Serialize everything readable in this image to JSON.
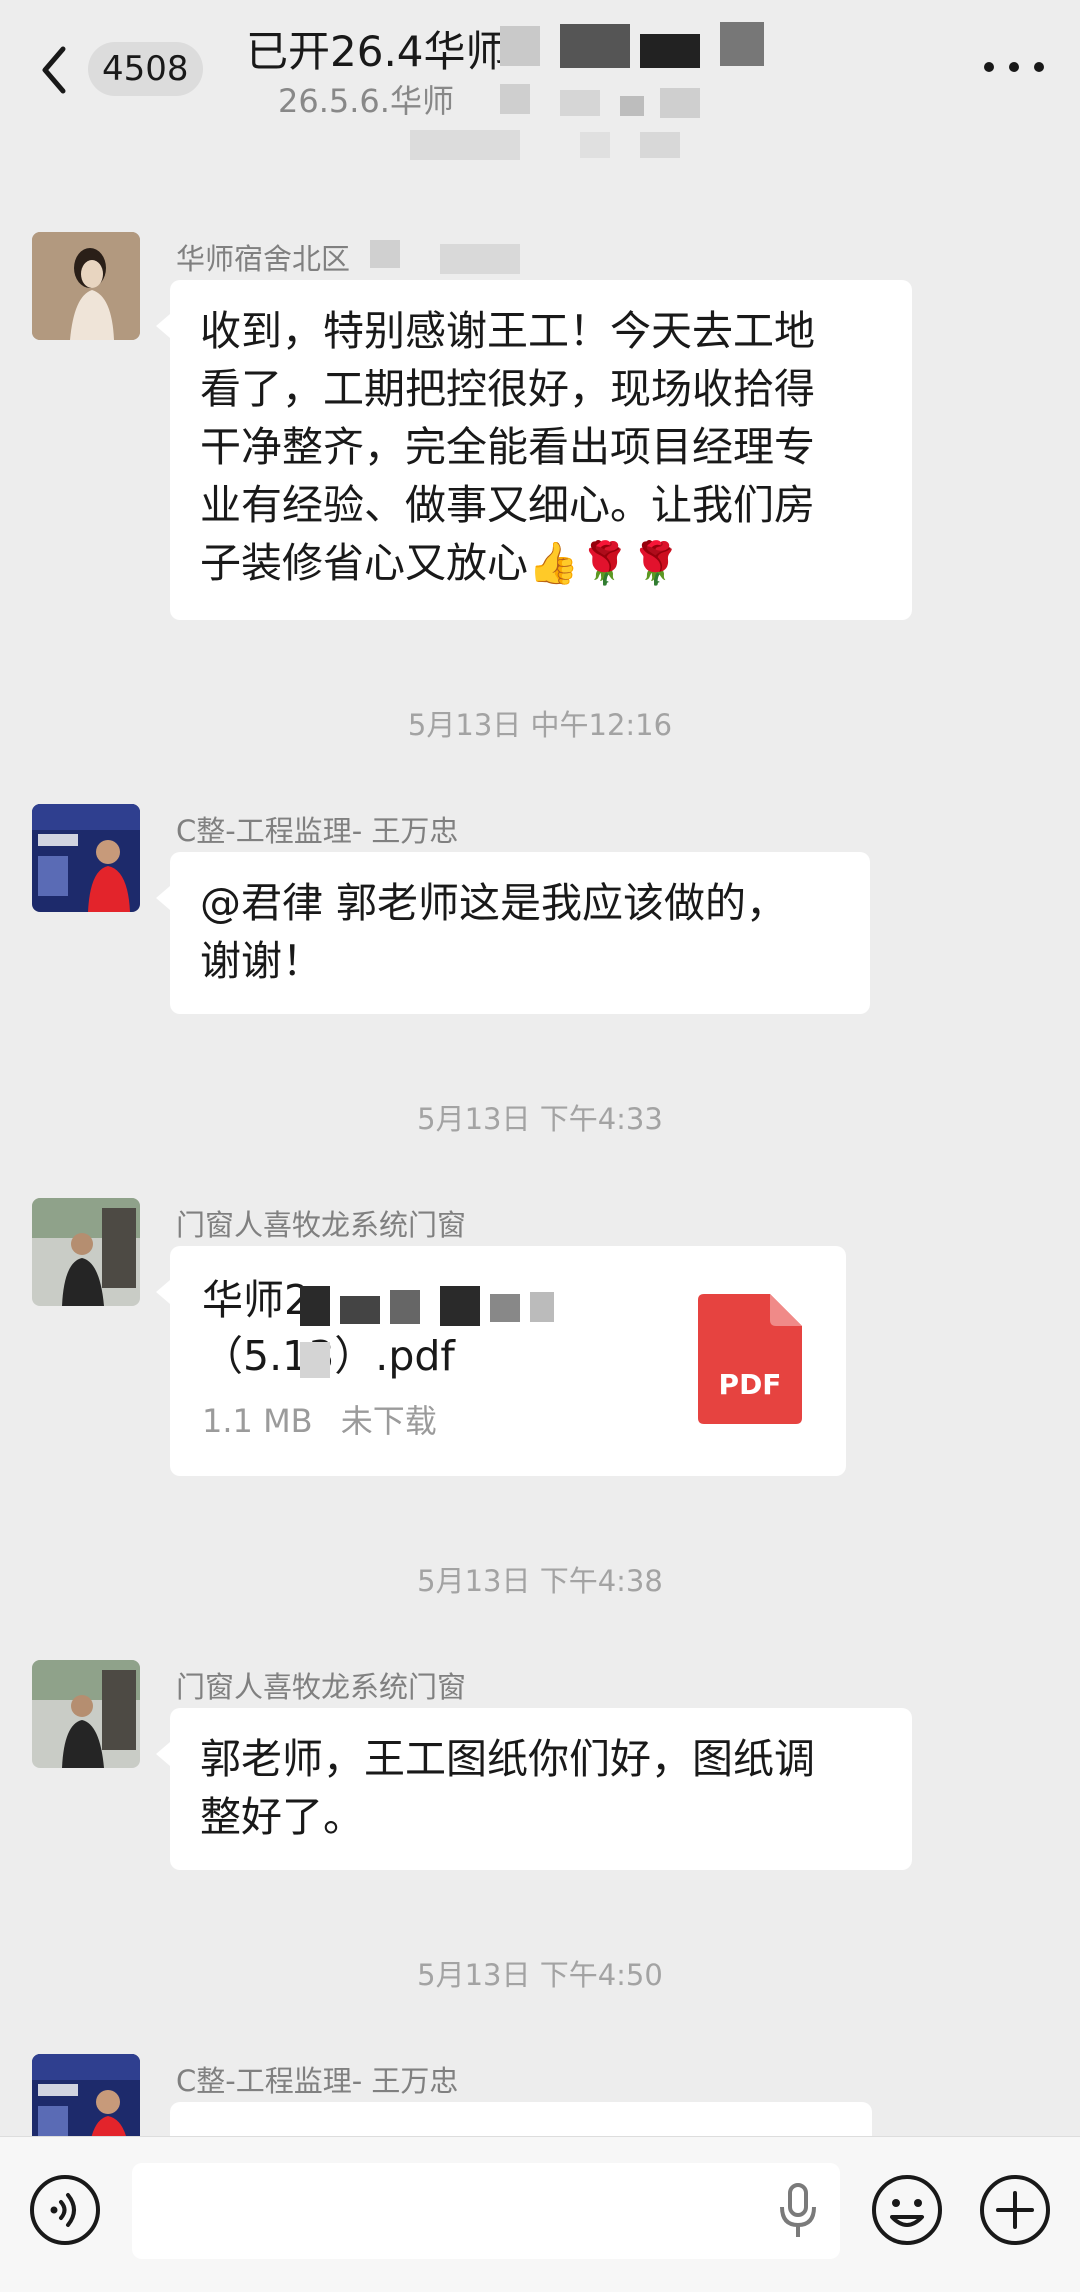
{
  "header": {
    "unread_count": "4508",
    "title": "已开26.4华师",
    "subtitle": "26.5.6.华师"
  },
  "messages": [
    {
      "sender": "华师宿舍北区",
      "text_lines": [
        "收到，特别感谢王工！今天去工地",
        "看了，工期把控很好，现场收拾得",
        "干净整齐，完全能看出项目经理专",
        "业有经验、做事又细心。让我们房",
        "子装修省心又放心👍🌹🌹"
      ]
    },
    {
      "time": "5月13日 中午12:16",
      "sender": "C整-工程监理- 王万忠",
      "text_lines": [
        "@君律  郭老师这是我应该做的，",
        "谢谢！"
      ]
    },
    {
      "time": "5月13日 下午4:33",
      "sender": "门窗人喜牧龙系统门窗",
      "file": {
        "name_line1": "华师2",
        "name_line2": "（5.13）.pdf",
        "size": "1.1 MB",
        "status": "未下载",
        "type_label": "PDF"
      }
    },
    {
      "time": "5月13日 下午4:38",
      "sender": "门窗人喜牧龙系统门窗",
      "text_lines": [
        "郭老师，王工图纸你们好，图纸调",
        "整好了。"
      ]
    },
    {
      "time": "5月13日 下午4:50",
      "sender": "C整-工程监理- 王万忠"
    }
  ],
  "icons": {
    "back": "chevron-left-icon",
    "more": "more-dots-icon",
    "voice": "voice-icon",
    "mic": "microphone-icon",
    "emoji": "emoji-icon",
    "plus": "plus-icon"
  },
  "colors": {
    "background": "#ededed",
    "bubble": "#ffffff",
    "pdf": "#e64340"
  }
}
